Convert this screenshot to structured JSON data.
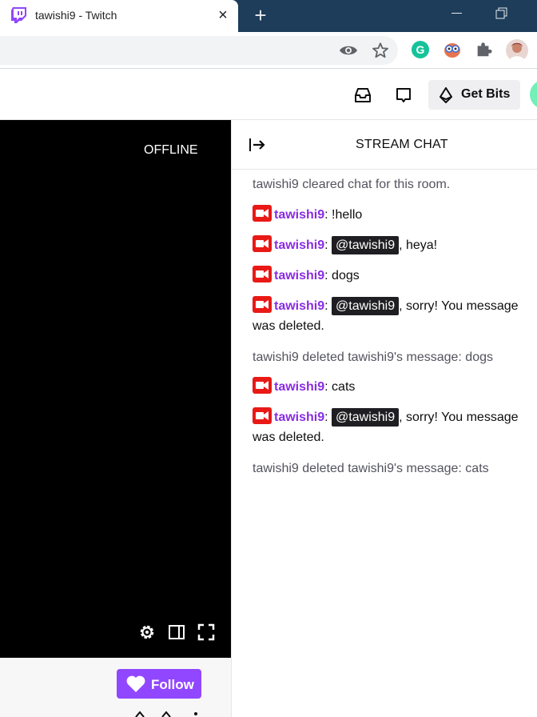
{
  "browser": {
    "tab_title": "tawishi9 - Twitch",
    "close_glyph": "×",
    "newtab_glyph": "+",
    "icons": [
      "twitch-favicon",
      "eye-icon",
      "star-icon",
      "grammarly-icon",
      "owl-extension-icon",
      "puzzle-icon",
      "profile-avatar"
    ]
  },
  "nav": {
    "get_bits_label": "Get Bits",
    "icons": [
      "inbox-icon",
      "whisper-icon",
      "bits-icon"
    ]
  },
  "player": {
    "status": "OFFLINE",
    "follow_label": "Follow"
  },
  "chat": {
    "title": "STREAM CHAT",
    "messages": [
      {
        "type": "system",
        "text": "tawishi9 cleared chat for this room."
      },
      {
        "type": "user",
        "user": "tawishi9",
        "sep": ":",
        "text": " !hello"
      },
      {
        "type": "user",
        "user": "tawishi9",
        "sep": ":",
        "mention": "@tawishi9",
        "text": ", heya!"
      },
      {
        "type": "user",
        "user": "tawishi9",
        "sep": ":",
        "text": " dogs"
      },
      {
        "type": "user",
        "user": "tawishi9",
        "sep": ":",
        "mention": "@tawishi9",
        "text": ", sorry! You message",
        "text2": "was deleted."
      },
      {
        "type": "system",
        "text": "tawishi9 deleted tawishi9's message: dogs"
      },
      {
        "type": "user",
        "user": "tawishi9",
        "sep": ":",
        "text": " cats"
      },
      {
        "type": "user",
        "user": "tawishi9",
        "sep": ":",
        "mention": "@tawishi9",
        "text": ", sorry! You message",
        "text2": "was deleted."
      },
      {
        "type": "system",
        "text": "tawishi9 deleted tawishi9's message: cats"
      }
    ]
  },
  "colors": {
    "accent": "#9147ff",
    "username": "#8a2be2",
    "badge": "#e91916",
    "tabbar": "#1d3d5a"
  }
}
